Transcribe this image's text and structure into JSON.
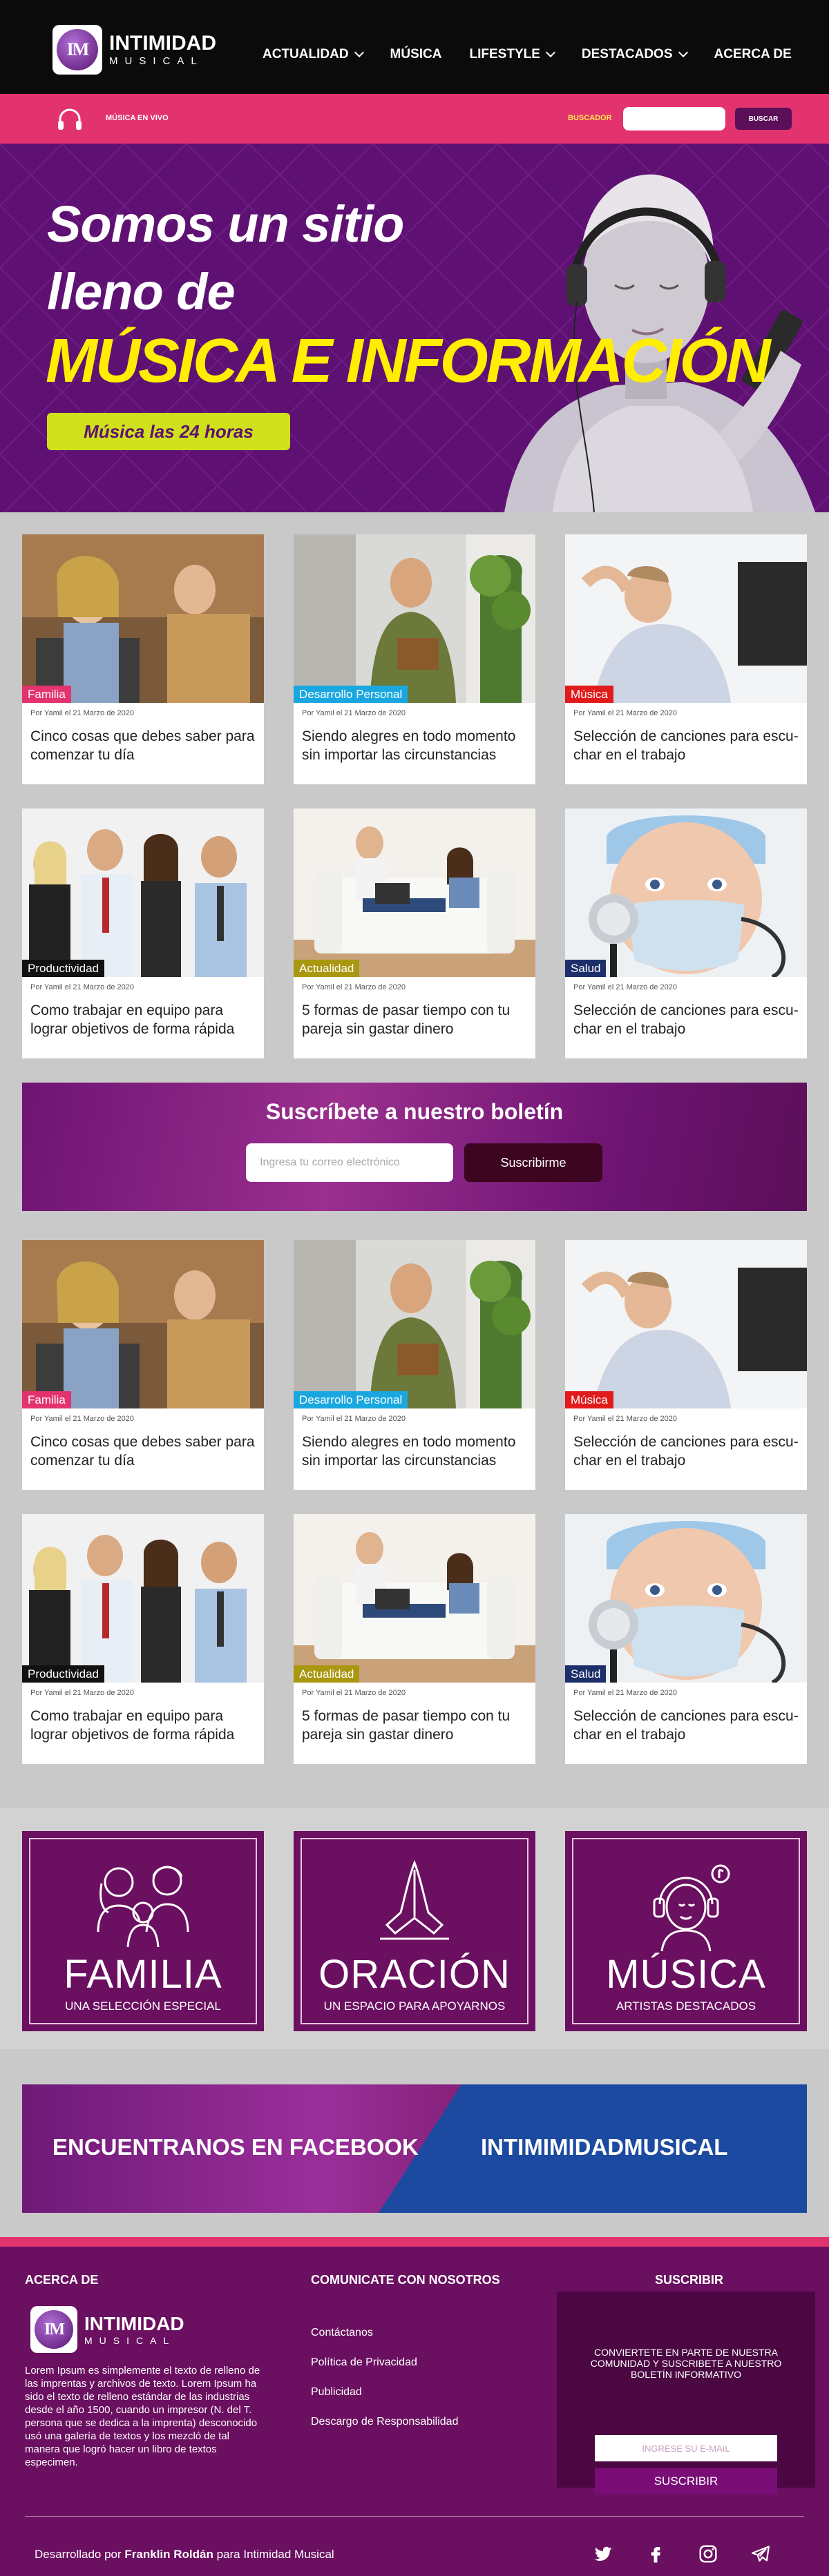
{
  "nav": {
    "logo_mark": "IM",
    "logo_line1": "INTIMIDAD",
    "logo_line2": "MUSICAL",
    "items": [
      {
        "label": "ACTUALIDAD",
        "dropdown": true
      },
      {
        "label": "MÚSICA",
        "dropdown": false
      },
      {
        "label": "LIFESTYLE",
        "dropdown": true
      },
      {
        "label": "DESTACADOS",
        "dropdown": true
      },
      {
        "label": "ACERCA DE",
        "dropdown": false
      }
    ]
  },
  "topbar": {
    "live_label": "MÚSICA EN VIVO",
    "search_label": "BUSCADOR",
    "search_value": "",
    "search_button": "BUSCAR",
    "icon": "headphones-icon"
  },
  "hero": {
    "line1": "Somos un sitio",
    "line2": "lleno de",
    "line3": "MÚSICA E INFORMACIÓN",
    "button": "Música las 24 horas"
  },
  "cards_a": [
    {
      "tag": "Familia",
      "tag_color": "#e3336f",
      "meta": "Por Yamil  el 21  Marzo de 2020",
      "title": "Cinco cosas que debes saber para comenzar tu día",
      "img": "office"
    },
    {
      "tag": "Desarrollo Personal",
      "tag_color": "#1aa7e0",
      "meta": "Por Yamil  el 21  Marzo de 2020",
      "title": "Siendo alegres en todo momento sin importar las circunstancias",
      "img": "phone"
    },
    {
      "tag": "Música",
      "tag_color": "#e11b1b",
      "meta": "Por Yamil  el 21  Marzo de 2020",
      "title": "Selección de canciones para escu-char en el trabajo",
      "img": "relax"
    },
    {
      "tag": "Productividad",
      "tag_color": "#111111",
      "meta": "Por Yamil  el 21  Marzo de 2020",
      "title": "Como trabajar en equipo para lograr objetivos de forma rápida",
      "img": "team"
    },
    {
      "tag": "Actualidad",
      "tag_color": "#a8970f",
      "meta": "Por Yamil  el 21  Marzo de 2020",
      "title": "5 formas de pasar tiempo con tu pareja sin gastar dinero",
      "img": "couch"
    },
    {
      "tag": "Salud",
      "tag_color": "#1d2f6b",
      "meta": "Por Yamil  el 21  Marzo de 2020",
      "title": "Selección de canciones para escu-char en el trabajo",
      "img": "doctor"
    }
  ],
  "cards_b": [
    {
      "tag": "Familia",
      "tag_color": "#e3336f",
      "meta": "Por Yamil  el 21  Marzo de 2020",
      "title": "Cinco cosas que debes saber para comenzar tu día",
      "img": "office"
    },
    {
      "tag": "Desarrollo Personal",
      "tag_color": "#1aa7e0",
      "meta": "Por Yamil  el 21  Marzo de 2020",
      "title": "Siendo alegres en todo momento sin importar las circunstancias",
      "img": "phone"
    },
    {
      "tag": "Música",
      "tag_color": "#e11b1b",
      "meta": "Por Yamil  el 21  Marzo de 2020",
      "title": "Selección de canciones para escu-char en el trabajo",
      "img": "relax"
    },
    {
      "tag": "Productividad",
      "tag_color": "#111111",
      "meta": "Por Yamil  el 21  Marzo de 2020",
      "title": "Como trabajar en equipo para lograr objetivos de forma rápida",
      "img": "team"
    },
    {
      "tag": "Actualidad",
      "tag_color": "#a8970f",
      "meta": "Por Yamil  el 21  Marzo de 2020",
      "title": "5 formas de pasar tiempo con tu pareja sin gastar dinero",
      "img": "couch"
    },
    {
      "tag": "Salud",
      "tag_color": "#1d2f6b",
      "meta": "Por Yamil  el 21  Marzo de 2020",
      "title": "Selección de canciones para escu-char en el trabajo",
      "img": "doctor"
    }
  ],
  "newsletter": {
    "title": "Suscríbete a nuestro boletín",
    "placeholder": "Ingresa tu correo electrónico",
    "button": "Suscribirme"
  },
  "categories": [
    {
      "name": "FAMILIA",
      "sub": "UNA SELECCIÓN ESPECIAL",
      "icon": "family-icon"
    },
    {
      "name": "ORACIÓN",
      "sub": "UN ESPACIO PARA APOYARNOS",
      "icon": "praying-hands-icon"
    },
    {
      "name": "MÚSICA",
      "sub": "ARTISTAS DESTACADOS",
      "icon": "headphones-girl-icon"
    }
  ],
  "facebook": {
    "left": "ENCUENTRANOS EN FACEBOOK",
    "right": "INTIMIMIDADMUSICAL"
  },
  "footer": {
    "about_heading": "ACERCA DE",
    "about_text": "Lorem Ipsum es simplemente el texto de relleno de las imprentas y archivos de texto. Lorem Ipsum ha sido el texto de relleno estándar de las industrias desde el año 1500, cuando un impresor (N. del T. persona que se dedica a la imprenta) desconocido usó una galería de textos y los mezcló de tal manera que logró hacer un libro de textos especimen.",
    "contact_heading": "COMUNICATE CON NOSOTROS",
    "links": [
      "Contáctanos",
      "Política de Privacidad",
      "Publicidad",
      "Descargo de Responsabilidad"
    ],
    "subscribe_heading": "SUSCRIBIR",
    "subscribe_text": "CONVIERTETE EN PARTE DE NUESTRA COMUNIDAD Y SUSCRIBETE A NUESTRO BOLETÍN INFORMATIVO",
    "email_placeholder": "INGRESE SU E-MAIL",
    "subscribe_button": "SUSCRIBIR",
    "credit_prefix": "Desarrollado por ",
    "credit_name": "Franklin Roldán",
    "credit_suffix": " para Intimidad Musical",
    "social": [
      "twitter-icon",
      "facebook-icon",
      "instagram-icon",
      "telegram-icon"
    ]
  },
  "colors": {
    "purple": "#5e1173",
    "pink": "#e3336f",
    "yellow": "#ffee00",
    "lime": "#cfe11a",
    "blue": "#1c4aa0"
  }
}
